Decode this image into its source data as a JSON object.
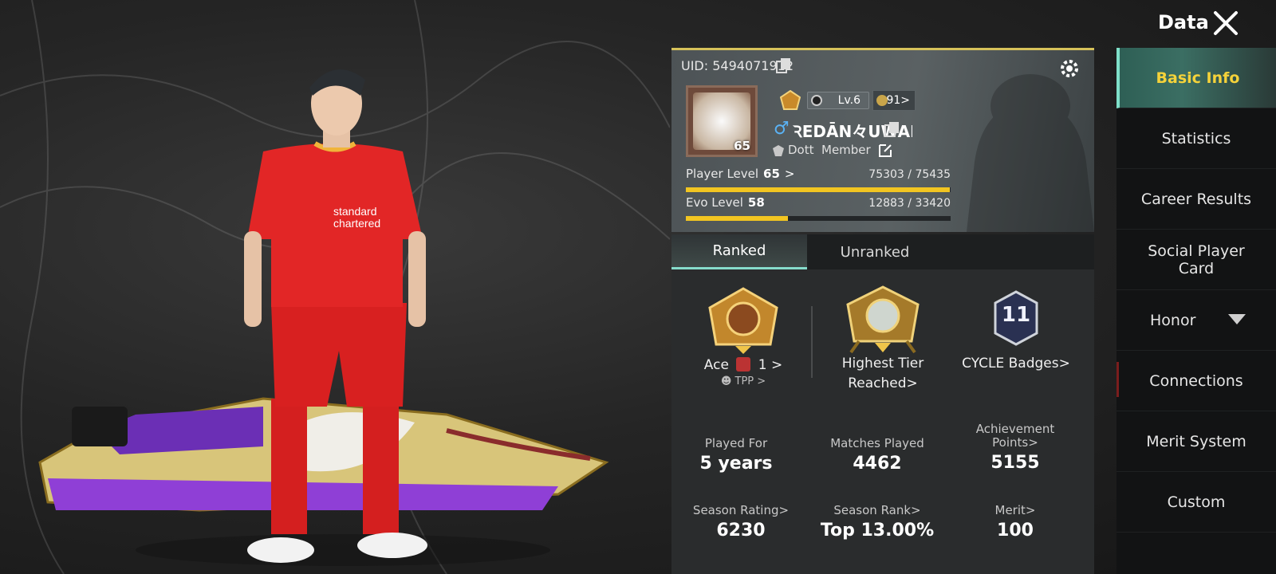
{
  "header": {
    "title": "Data"
  },
  "profile": {
    "uid": "UID: 5494071912",
    "avatar_level": "65",
    "account_level": "Lv.6",
    "rank_value": "91>",
    "gender_symbol": "♂",
    "player_name": "ꝚEDĀN々UWAI.",
    "clan_name": "Dott",
    "clan_role": "Member",
    "player_level_label": "Player Level",
    "player_level": "65",
    "player_level_arrow": ">",
    "player_level_progress": "75303 / 75435",
    "player_level_fraction": 0.998,
    "evo_level_label": "Evo Level",
    "evo_level": "58",
    "evo_level_progress": "12883 / 33420",
    "evo_level_fraction": 0.385
  },
  "tabs": [
    {
      "label": "Ranked",
      "active": true
    },
    {
      "label": "Unranked",
      "active": false
    }
  ],
  "badges": {
    "tier": {
      "name": "Ace",
      "sub": "1 >",
      "mode": "TPP >"
    },
    "highest_tier": {
      "label_1": "Highest Tier",
      "label_2": "Reached>"
    },
    "cycle": {
      "number": "11",
      "label": "CYCLE Badges>"
    }
  },
  "stats": {
    "played_for": {
      "label": "Played For",
      "value": "5 years"
    },
    "matches_played": {
      "label": "Matches Played",
      "value": "4462"
    },
    "achievement_points": {
      "label_1": "Achievement",
      "label_2": "Points>",
      "value": "5155"
    },
    "season_rating": {
      "label": "Season Rating>",
      "value": "6230"
    },
    "season_rank": {
      "label": "Season Rank>",
      "value": "Top 13.00%"
    },
    "merit": {
      "label": "Merit>",
      "value": "100"
    }
  },
  "nav": {
    "items": [
      {
        "label": "Basic Info",
        "active": true
      },
      {
        "label": "Statistics"
      },
      {
        "label": "Career Results"
      },
      {
        "label": "Social Player Card"
      },
      {
        "label": "Honor"
      },
      {
        "label": "Connections"
      },
      {
        "label": "Merit System"
      },
      {
        "label": "Custom"
      }
    ]
  },
  "colors": {
    "accent_yellow": "#f2c521",
    "accent_teal": "#86dccb",
    "active_nav_text": "#f5d23a"
  }
}
